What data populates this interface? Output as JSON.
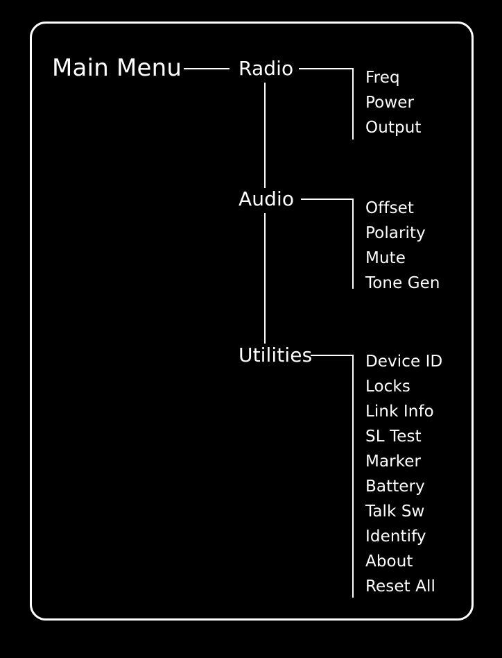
{
  "diagram": {
    "title": "Main Menu",
    "type": "menu-tree",
    "background_color": "#000000",
    "line_color": "#ffffff",
    "text_color": "#ffffff",
    "root": {
      "label": "Main Menu"
    },
    "branches": [
      {
        "label": "Radio",
        "items": [
          {
            "label": "Freq"
          },
          {
            "label": "Power"
          },
          {
            "label": "Output"
          }
        ]
      },
      {
        "label": "Audio",
        "items": [
          {
            "label": "Offset"
          },
          {
            "label": "Polarity"
          },
          {
            "label": "Mute"
          },
          {
            "label": "Tone Gen"
          }
        ]
      },
      {
        "label": "Utilities",
        "items": [
          {
            "label": "Device ID"
          },
          {
            "label": "Locks"
          },
          {
            "label": "Link Info"
          },
          {
            "label": "SL Test"
          },
          {
            "label": "Marker"
          },
          {
            "label": "Battery"
          },
          {
            "label": "Talk Sw"
          },
          {
            "label": "Identify"
          },
          {
            "label": "About"
          },
          {
            "label": "Reset All"
          }
        ]
      }
    ]
  }
}
